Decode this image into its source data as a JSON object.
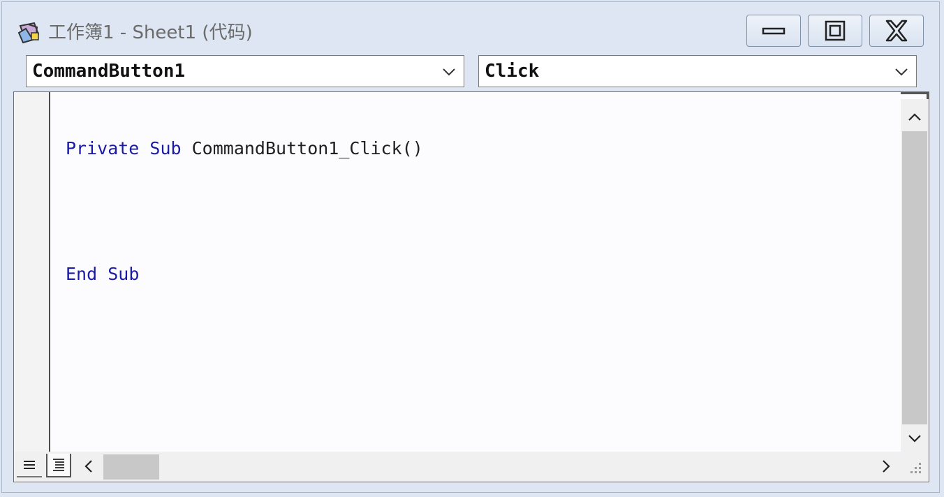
{
  "window": {
    "title": "工作簿1 - Sheet1 (代码)",
    "icon": "vba-module-icon",
    "controls": [
      "minimize-icon",
      "maximize-icon",
      "close-icon"
    ]
  },
  "object_combo": {
    "value": "CommandButton1"
  },
  "procedure_combo": {
    "value": "Click"
  },
  "code": {
    "line1": {
      "kw1": "Private",
      "kw2": "Sub",
      "rest": " CommandButton1_Click()"
    },
    "line2": {
      "kw1": "End",
      "kw2": "Sub"
    }
  },
  "colors": {
    "keyword": "#1a1aa6",
    "text": "#1f1f1f",
    "frame": "#dde6f2"
  }
}
